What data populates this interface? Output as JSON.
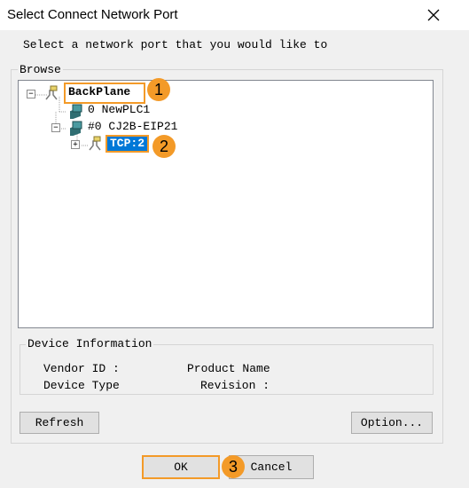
{
  "window": {
    "title": "Select Connect Network Port"
  },
  "instruction": "Select a network port that you would like to",
  "browse": {
    "legend": "Browse",
    "tree": {
      "root": {
        "label": "BackPlane",
        "expander": "−"
      },
      "items": [
        {
          "label": "0 NewPLC1"
        },
        {
          "label": "#0 CJ2B-EIP21",
          "expander": "−"
        },
        {
          "label": "TCP:2",
          "expander": "+",
          "selected": true
        }
      ]
    }
  },
  "device_info": {
    "legend": "Device Information",
    "vendor_id_label": "Vendor ID :",
    "product_name_label": "Product Name",
    "device_type_label": "Device Type",
    "revision_label": "Revision :"
  },
  "buttons": {
    "refresh": "Refresh",
    "option": "Option...",
    "ok": "OK",
    "cancel": "Cancel"
  },
  "callouts": [
    "1",
    "2",
    "3"
  ],
  "colors": {
    "accent": "#f39a28",
    "selection": "#0078d7"
  }
}
